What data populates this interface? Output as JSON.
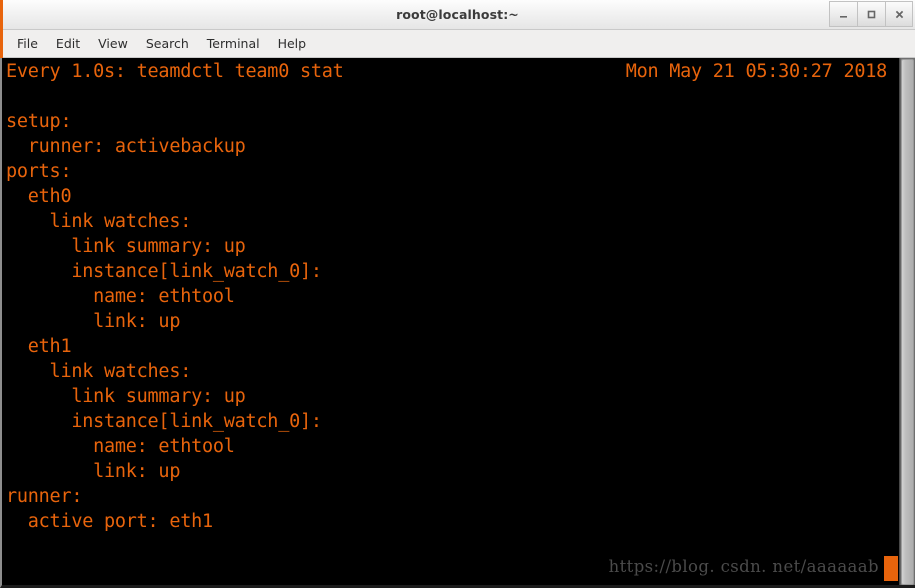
{
  "window": {
    "title": "root@localhost:~",
    "controls": [
      {
        "name": "minimize",
        "glyph": "_"
      },
      {
        "name": "maximize",
        "glyph": "□"
      },
      {
        "name": "close",
        "glyph": "✕"
      }
    ]
  },
  "menubar": {
    "items": [
      {
        "label": "File"
      },
      {
        "label": "Edit"
      },
      {
        "label": "View"
      },
      {
        "label": "Search"
      },
      {
        "label": "Terminal"
      },
      {
        "label": "Help"
      }
    ]
  },
  "terminal": {
    "foreground_color": "#e8640c",
    "background_color": "#000000",
    "watch_header": {
      "command": "Every 1.0s: teamdctl team0 stat",
      "timestamp": "Mon May 21 05:30:27 2018"
    },
    "lines": [
      "",
      "setup:",
      "  runner: activebackup",
      "ports:",
      "  eth0",
      "    link watches:",
      "      link summary: up",
      "      instance[link_watch_0]:",
      "        name: ethtool",
      "        link: up",
      "  eth1",
      "    link watches:",
      "      link summary: up",
      "      instance[link_watch_0]:",
      "        name: ethtool",
      "        link: up",
      "runner:",
      "  active port: eth1"
    ]
  },
  "watermark": {
    "text": "https://blog. csdn. net/aaaaaab"
  }
}
